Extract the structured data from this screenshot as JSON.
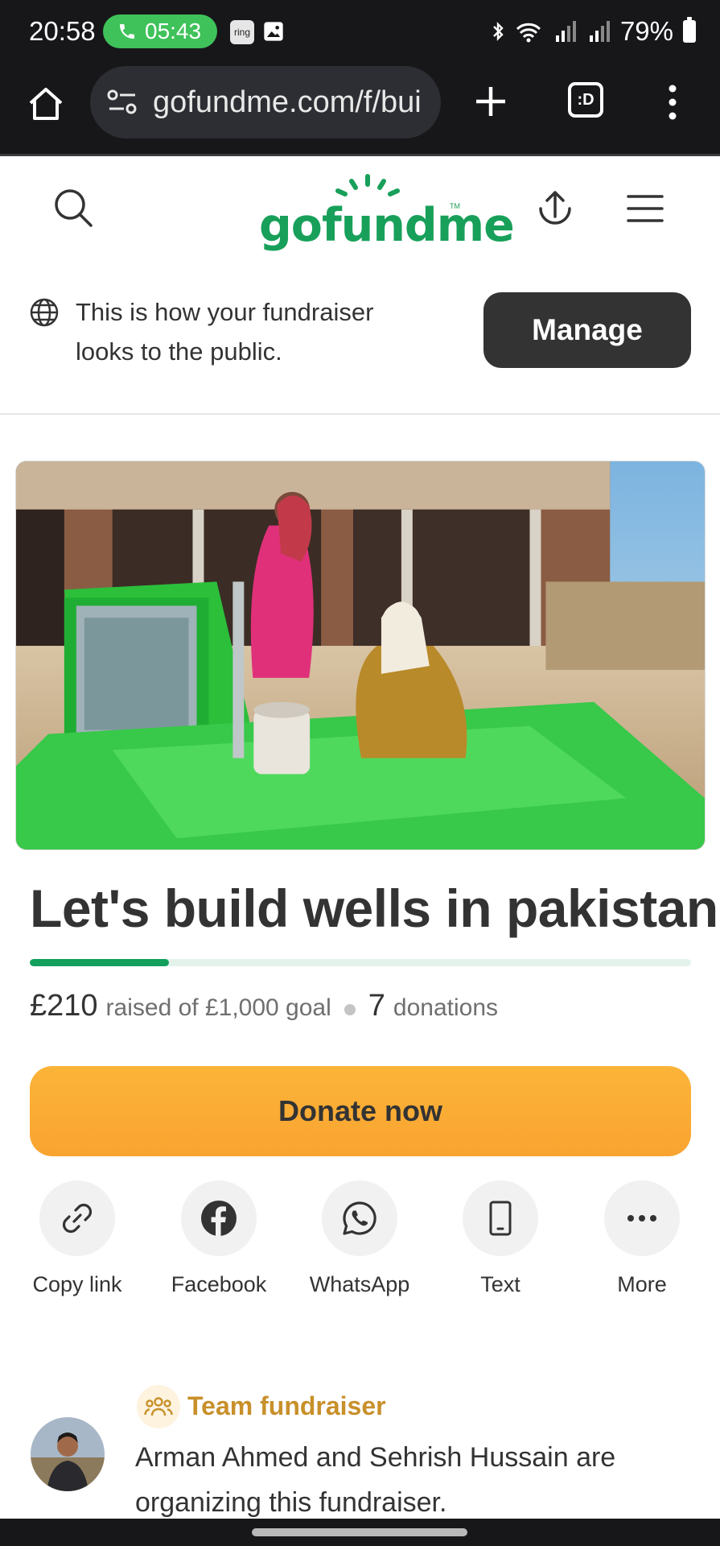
{
  "status_bar": {
    "time": "20:58",
    "call_timer": "05:43",
    "ring_app_label": "ring",
    "battery": "79%"
  },
  "browser": {
    "url": "gofundme.com/f/bui",
    "tab_count_label": ":D"
  },
  "site": {
    "logo_text": "gofundme",
    "logo_tm": "TM",
    "brand_color": "#18a05a"
  },
  "notice": {
    "text": "This is how your fundraiser looks to the public.",
    "manage_label": "Manage"
  },
  "fundraiser": {
    "title": "Let's build wells in pakistan",
    "raised": "£210",
    "raised_suffix": "raised of £1,000 goal",
    "donations_count": "7",
    "donations_label": "donations",
    "progress": 0.21
  },
  "donate": {
    "label": "Donate now",
    "color": "#f9a431"
  },
  "share": [
    {
      "label": "Copy link",
      "icon": "link-icon"
    },
    {
      "label": "Facebook",
      "icon": "facebook-icon"
    },
    {
      "label": "WhatsApp",
      "icon": "whatsapp-icon"
    },
    {
      "label": "Text",
      "icon": "phone-icon"
    },
    {
      "label": "More",
      "icon": "more-icon"
    }
  ],
  "organizer": {
    "team_label": "Team fundraiser",
    "text": "Arman Ahmed and Sehrish Hussain are organizing this fundraiser."
  }
}
